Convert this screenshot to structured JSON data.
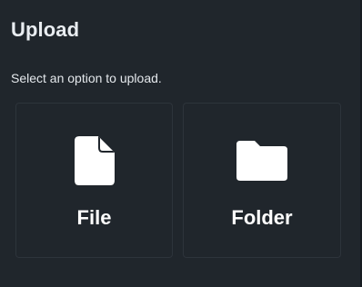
{
  "dialog": {
    "title": "Upload",
    "subtitle": "Select an option to upload."
  },
  "options": [
    {
      "label": "File",
      "icon": "file-icon"
    },
    {
      "label": "Folder",
      "icon": "folder-icon"
    }
  ],
  "colors": {
    "background": "#20262c",
    "card_border": "#2d343b",
    "icon": "#ffffff",
    "text": "#ffffff"
  }
}
